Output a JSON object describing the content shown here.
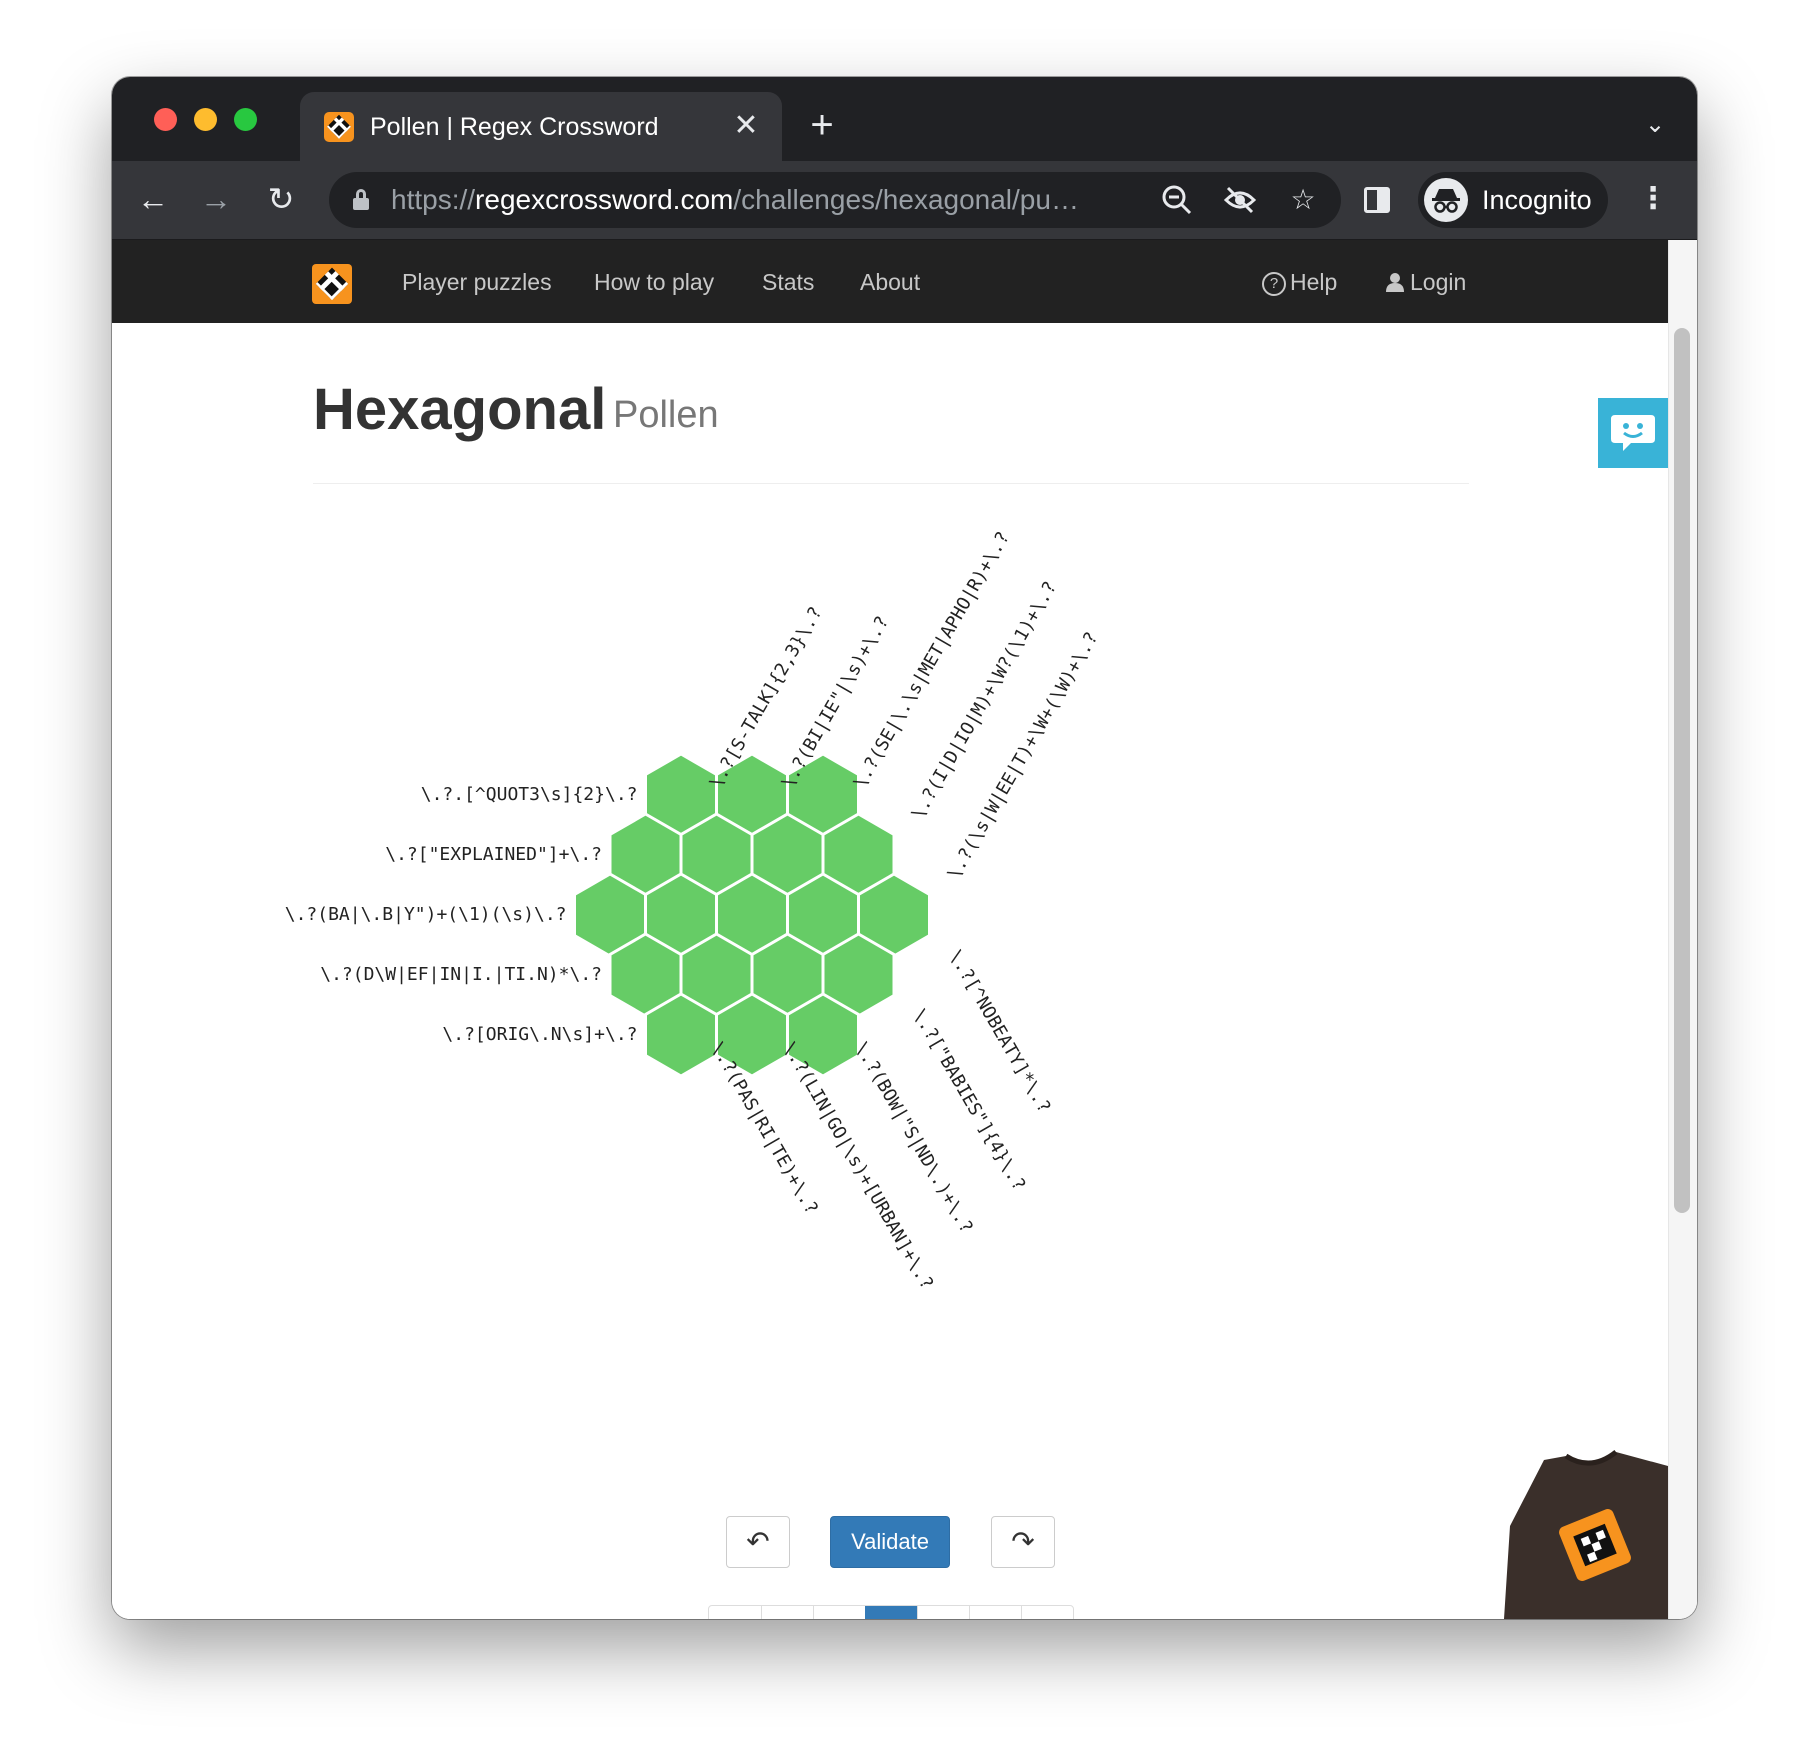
{
  "browser": {
    "tab_title": "Pollen | Regex Crossword",
    "tab_close": "✕",
    "new_tab": "+",
    "tab_menu": "⌄",
    "url_scheme": "https://",
    "url_host": "regexcrossword.com",
    "url_path": "/challenges/hexagonal/pu…",
    "profile_label": "Incognito",
    "icons": [
      "back-arrow-icon",
      "forward-arrow-icon",
      "reload-icon",
      "lock-icon",
      "zoom-icon",
      "eye-off-icon",
      "star-icon",
      "side-panel-icon",
      "incognito-icon",
      "kebab-menu-icon"
    ]
  },
  "navbar": {
    "links": [
      "Player puzzles",
      "How to play",
      "Stats",
      "About"
    ],
    "help": "Help",
    "login": "Login"
  },
  "page": {
    "title": "Hexagonal",
    "subtitle": "Pollen"
  },
  "puzzle": {
    "cell_color": "#66cc66",
    "rows": [
      3,
      4,
      5,
      4,
      3
    ],
    "left_clues": [
      "\\.?.[^QUOT3\\s]{2}\\.?",
      "\\.?[\"EXPLAINED\"]+\\.?",
      "\\.?(BA|\\.B|Y\")+(\\1)(\\s)\\.?",
      "\\.?(D\\W|EF|IN|I.|TI.N)*\\.?",
      "\\.?[ORIG\\.N\\s]+\\.?"
    ],
    "top_clues": [
      "\\.?[S-TALK]{2,3}\\.?",
      "\\.?(BI|IE\"|\\s)+\\.?",
      "\\.?(SE|\\.\\s|MET|APHO|R)+\\.?",
      "\\.?(I|D|IO|M)+\\W?(\\1)+\\.?",
      "\\.?(\\s|W|EE|T)+\\W+(\\W)+\\.?"
    ],
    "bottom_clues": [
      "\\.?[^NOBEATY]*\\.?",
      "\\.?[\"BABIES\"]{4}\\.?",
      "\\.?(BOW|\"S|ND\\.)+\\.?",
      "\\.?(LIN|GO|\\s)+[URBAN]+\\.?",
      "\\.?(PAS|RI|TE)+\\.?"
    ]
  },
  "controls": {
    "undo": "↶",
    "validate": "Validate",
    "redo": "↷"
  },
  "colors": {
    "navbar_bg": "#222222",
    "brand_orange": "#f7931e",
    "validate_blue": "#337ab7",
    "feedback_cyan": "#39b3d7",
    "hex_green": "#66cc66"
  }
}
